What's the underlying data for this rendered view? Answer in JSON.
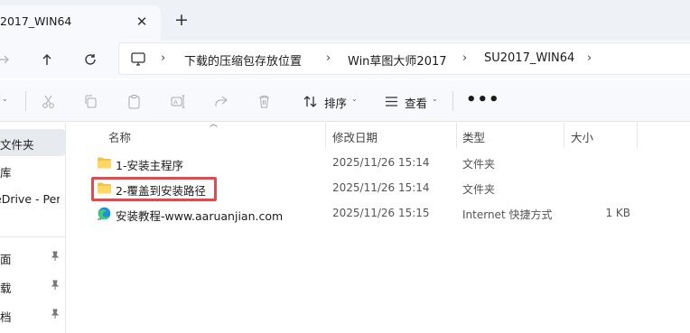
{
  "tab": {
    "title": "2017_WIN64",
    "close_symbol": "✕",
    "new_tab_symbol": "+"
  },
  "address": {
    "crumbs": [
      "下载的压缩包存放位置",
      "Win草图大师2017",
      "SU2017_WIN64"
    ],
    "separator": "›",
    "trailing_separator": "›"
  },
  "toolbar": {
    "sort_label": "排序",
    "view_label": "查看",
    "more_label": "•••",
    "icons": [
      "cut-icon",
      "copy-icon",
      "paste-icon",
      "rename-icon",
      "share-icon",
      "delete-icon",
      "sort-icon",
      "view-icon"
    ]
  },
  "sidebar": {
    "items": [
      {
        "label": "文件夹",
        "selected": true,
        "pinned": false
      },
      {
        "label": "库",
        "selected": false,
        "pinned": false
      },
      {
        "label": "eDrive - Per",
        "selected": false,
        "pinned": false
      },
      {
        "label": "面",
        "selected": false,
        "pinned": true
      },
      {
        "label": "载",
        "selected": false,
        "pinned": true
      },
      {
        "label": "档",
        "selected": false,
        "pinned": true
      }
    ]
  },
  "columns": {
    "name": "名称",
    "modified": "修改日期",
    "type": "类型",
    "size": "大小"
  },
  "files": [
    {
      "name": "1-安装主程序",
      "modified": "2025/11/26 15:14",
      "type": "文件夹",
      "size": "",
      "icon": "folder-icon"
    },
    {
      "name": "2-覆盖到安装路径",
      "modified": "2025/11/26 15:14",
      "type": "文件夹",
      "size": "",
      "icon": "folder-icon"
    },
    {
      "name": "安装教程-www.aaruanjian.com",
      "modified": "2025/11/26 15:15",
      "type": "Internet 快捷方式",
      "size": "1 KB",
      "icon": "edge-shortcut-icon"
    }
  ],
  "colors": {
    "highlight": "#e5484d",
    "folder": "#f5c242",
    "selected_bg": "#e7eaee"
  }
}
